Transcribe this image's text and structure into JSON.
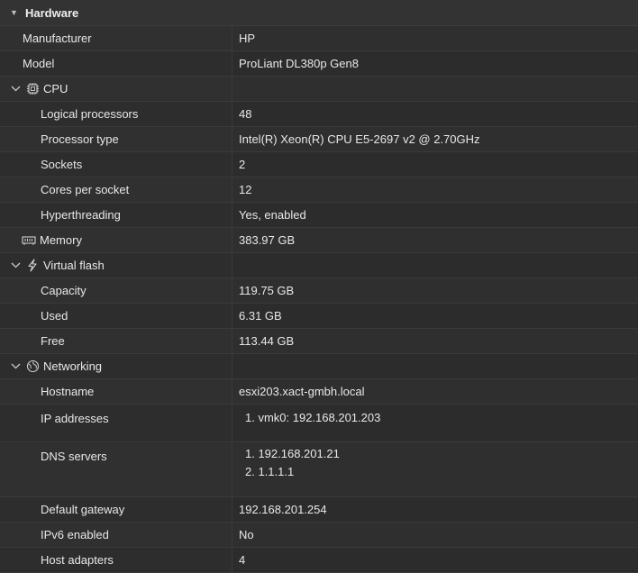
{
  "header": {
    "title": "Hardware"
  },
  "manufacturer": {
    "label": "Manufacturer",
    "value": "HP"
  },
  "model": {
    "label": "Model",
    "value": "ProLiant DL380p Gen8"
  },
  "cpu": {
    "label": "CPU",
    "logical_processors": {
      "label": "Logical processors",
      "value": "48"
    },
    "processor_type": {
      "label": "Processor type",
      "value": "Intel(R) Xeon(R) CPU E5-2697 v2 @ 2.70GHz"
    },
    "sockets": {
      "label": "Sockets",
      "value": "2"
    },
    "cores_per_socket": {
      "label": "Cores per socket",
      "value": "12"
    },
    "hyperthreading": {
      "label": "Hyperthreading",
      "value": "Yes, enabled"
    }
  },
  "memory": {
    "label": "Memory",
    "value": "383.97 GB"
  },
  "virtual_flash": {
    "label": "Virtual flash",
    "capacity": {
      "label": "Capacity",
      "value": "119.75 GB"
    },
    "used": {
      "label": "Used",
      "value": "6.31 GB"
    },
    "free": {
      "label": "Free",
      "value": "113.44 GB"
    }
  },
  "networking": {
    "label": "Networking",
    "hostname": {
      "label": "Hostname",
      "value": "esxi203.xact-gmbh.local"
    },
    "ip_addresses": {
      "label": "IP addresses",
      "items": [
        "1. vmk0: 192.168.201.203"
      ]
    },
    "dns_servers": {
      "label": "DNS servers",
      "items": [
        "1. 192.168.201.21",
        "2. 1.1.1.1"
      ]
    },
    "default_gateway": {
      "label": "Default gateway",
      "value": "192.168.201.254"
    },
    "ipv6_enabled": {
      "label": "IPv6 enabled",
      "value": "No"
    },
    "host_adapters": {
      "label": "Host adapters",
      "value": "4"
    }
  },
  "icons": {
    "header_caret": "caret-down-icon",
    "cpu": "cpu-chip-icon",
    "memory": "memory-module-icon",
    "virtual_flash": "lightning-icon",
    "networking": "network-globe-icon"
  }
}
